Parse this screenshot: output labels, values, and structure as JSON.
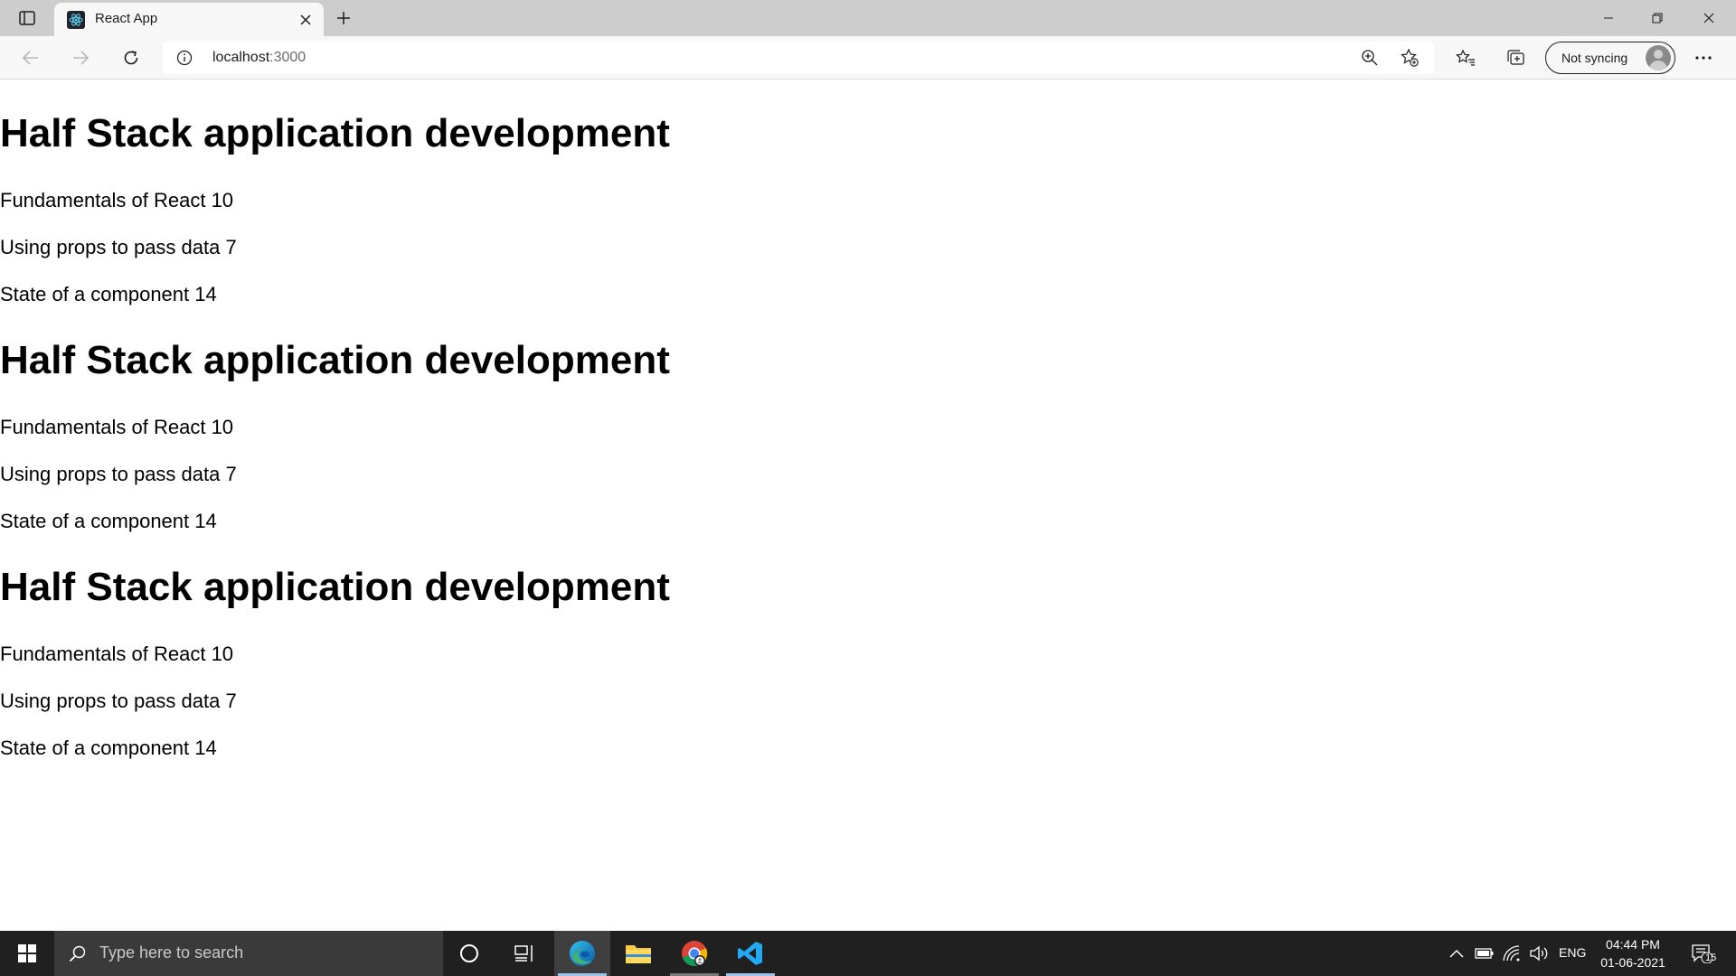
{
  "browser": {
    "tab": {
      "title": "React App"
    },
    "address": {
      "host": "localhost",
      "port": ":3000"
    },
    "profile": {
      "label": "Not syncing"
    }
  },
  "page": {
    "sections": [
      {
        "title": "Half Stack application development",
        "parts": [
          {
            "text": "Fundamentals of React 10"
          },
          {
            "text": "Using props to pass data 7"
          },
          {
            "text": "State of a component 14"
          }
        ]
      },
      {
        "title": "Half Stack application development",
        "parts": [
          {
            "text": "Fundamentals of React 10"
          },
          {
            "text": "Using props to pass data 7"
          },
          {
            "text": "State of a component 14"
          }
        ]
      },
      {
        "title": "Half Stack application development",
        "parts": [
          {
            "text": "Fundamentals of React 10"
          },
          {
            "text": "Using props to pass data 7"
          },
          {
            "text": "State of a component 14"
          }
        ]
      }
    ]
  },
  "taskbar": {
    "search_placeholder": "Type here to search",
    "language": "ENG",
    "time": "04:44 PM",
    "date": "01-06-2021",
    "notification_count": "15"
  },
  "colors": {
    "titlebar": "#cdcdcd",
    "toolbar": "#f7f7f7",
    "taskbar": "#202020",
    "taskbar_search": "#3a3a3a",
    "active_indicator": "#9ac3ee"
  }
}
